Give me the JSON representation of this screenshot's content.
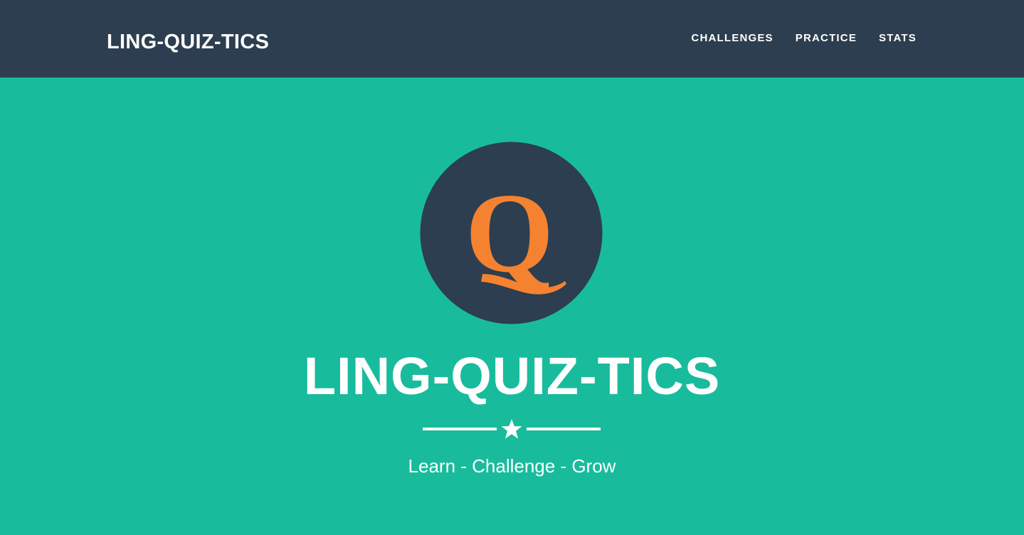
{
  "navbar": {
    "brand": "LING-QUIZ-TICS",
    "links": [
      {
        "label": "CHALLENGES"
      },
      {
        "label": "PRACTICE"
      },
      {
        "label": "STATS"
      }
    ]
  },
  "hero": {
    "logo_letter": "Q",
    "title": "LING-QUIZ-TICS",
    "divider_icon": "star-icon",
    "tagline": "Learn - Challenge - Grow"
  },
  "colors": {
    "navbar_bg": "#2c3e50",
    "hero_bg": "#18bc9c",
    "logo_circle": "#2c3e50",
    "logo_letter": "#f58231",
    "text": "#ffffff"
  }
}
